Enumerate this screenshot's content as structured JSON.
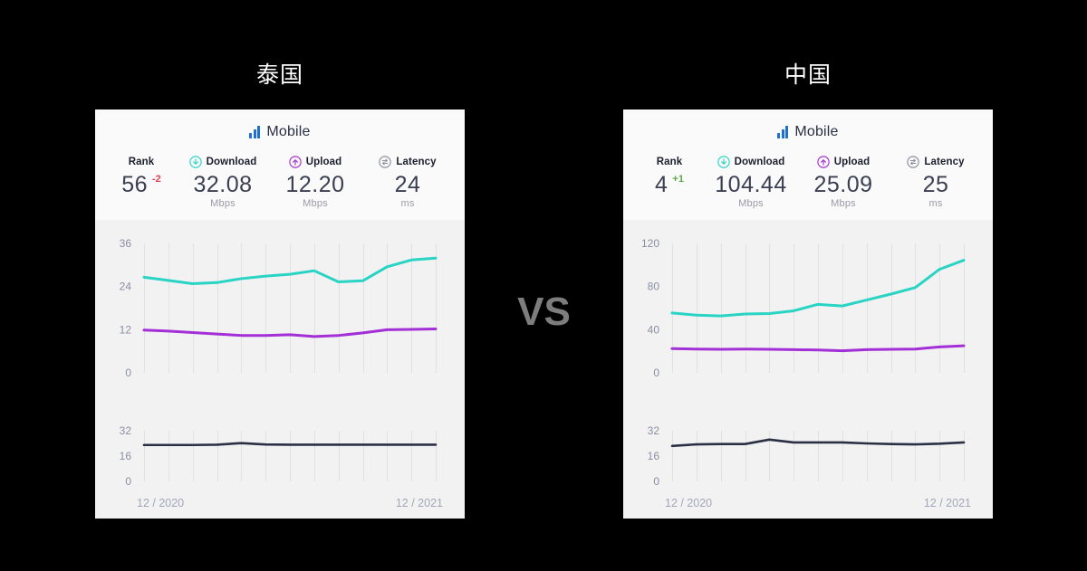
{
  "page": {
    "background": "#000000",
    "vs_label": "VS"
  },
  "colors": {
    "download": "#2ad4c4",
    "upload": "#a32fd6",
    "latency": "#2b2f44",
    "mobile_icon": "#1f6fd0",
    "rank_down": "#e03b4e",
    "rank_up": "#5aa845",
    "card_header_bg": "#fafafa",
    "card_body_bg": "#f2f2f2",
    "axis_text": "#8b8ea3",
    "gridline": "#e2e2e5"
  },
  "cards": [
    {
      "country": "泰国",
      "header": {
        "connection_type": "Mobile",
        "icon": "mobile-signal-bars-icon"
      },
      "metrics": [
        {
          "key": "rank",
          "label": "Rank",
          "icon": null,
          "value": "56",
          "unit": "",
          "delta": "-2",
          "delta_direction": "down"
        },
        {
          "key": "download",
          "label": "Download",
          "icon": "download-arrow-circle-icon",
          "value": "32.08",
          "unit": "Mbps",
          "delta": null,
          "delta_direction": null
        },
        {
          "key": "upload",
          "label": "Upload",
          "icon": "upload-arrow-circle-icon",
          "value": "12.20",
          "unit": "Mbps",
          "delta": null,
          "delta_direction": null
        },
        {
          "key": "latency",
          "label": "Latency",
          "icon": "latency-exchange-circle-icon",
          "value": "24",
          "unit": "ms",
          "delta": null,
          "delta_direction": null
        }
      ],
      "speed_chart": {
        "type": "line",
        "title": "",
        "xlabel": "",
        "ylabel": "",
        "ylim": [
          0,
          36
        ],
        "yticks": [
          0,
          12,
          24,
          36
        ],
        "ytick_labels": [
          "0",
          "12",
          "24",
          "36"
        ],
        "grid": true,
        "x": [
          "12 / 2020",
          "01 / 2021",
          "02 / 2021",
          "03 / 2021",
          "04 / 2021",
          "05 / 2021",
          "06 / 2021",
          "07 / 2021",
          "08 / 2021",
          "09 / 2021",
          "10 / 2021",
          "11 / 2021",
          "12 / 2021"
        ],
        "xtick_labels": [
          "12 / 2020",
          "12 / 2021"
        ],
        "series": [
          {
            "name": "Download",
            "color": "#2ad4c4",
            "values": [
              26.6,
              25.7,
              24.8,
              25.1,
              26.2,
              26.9,
              27.4,
              28.4,
              25.3,
              25.6,
              29.5,
              31.4,
              31.9
            ]
          },
          {
            "name": "Upload",
            "color": "#a32fd6",
            "values": [
              11.9,
              11.6,
              11.2,
              10.8,
              10.4,
              10.4,
              10.6,
              10.1,
              10.4,
              11.1,
              12.0,
              12.1,
              12.2
            ]
          }
        ]
      },
      "latency_chart": {
        "type": "line",
        "ylim": [
          0,
          32
        ],
        "yticks": [
          0,
          16,
          32
        ],
        "ytick_labels": [
          "0",
          "16",
          "32"
        ],
        "grid": true,
        "x": [
          "12 / 2020",
          "01 / 2021",
          "02 / 2021",
          "03 / 2021",
          "04 / 2021",
          "05 / 2021",
          "06 / 2021",
          "07 / 2021",
          "08 / 2021",
          "09 / 2021",
          "10 / 2021",
          "11 / 2021",
          "12 / 2021"
        ],
        "xtick_labels": [
          "12 / 2020",
          "12 / 2021"
        ],
        "series": [
          {
            "name": "Latency",
            "color": "#2b2f44",
            "values": [
              23.0,
              23.0,
              23.0,
              23.2,
              24.2,
              23.3,
              23.2,
              23.2,
              23.2,
              23.2,
              23.2,
              23.2,
              23.2
            ]
          }
        ]
      }
    },
    {
      "country": "中国",
      "header": {
        "connection_type": "Mobile",
        "icon": "mobile-signal-bars-icon"
      },
      "metrics": [
        {
          "key": "rank",
          "label": "Rank",
          "icon": null,
          "value": "4",
          "unit": "",
          "delta": "+1",
          "delta_direction": "up"
        },
        {
          "key": "download",
          "label": "Download",
          "icon": "download-arrow-circle-icon",
          "value": "104.44",
          "unit": "Mbps",
          "delta": null,
          "delta_direction": null
        },
        {
          "key": "upload",
          "label": "Upload",
          "icon": "upload-arrow-circle-icon",
          "value": "25.09",
          "unit": "Mbps",
          "delta": null,
          "delta_direction": null
        },
        {
          "key": "latency",
          "label": "Latency",
          "icon": "latency-exchange-circle-icon",
          "value": "25",
          "unit": "ms",
          "delta": null,
          "delta_direction": null
        }
      ],
      "speed_chart": {
        "type": "line",
        "ylim": [
          0,
          120
        ],
        "yticks": [
          0,
          40,
          80,
          120
        ],
        "ytick_labels": [
          "0",
          "40",
          "80",
          "120"
        ],
        "grid": true,
        "x": [
          "12 / 2020",
          "01 / 2021",
          "02 / 2021",
          "03 / 2021",
          "04 / 2021",
          "05 / 2021",
          "06 / 2021",
          "07 / 2021",
          "08 / 2021",
          "09 / 2021",
          "10 / 2021",
          "11 / 2021",
          "12 / 2021"
        ],
        "xtick_labels": [
          "12 / 2020",
          "12 / 2021"
        ],
        "series": [
          {
            "name": "Download",
            "color": "#2ad4c4",
            "values": [
              55.5,
              53.5,
              52.8,
              54.5,
              55.0,
              57.5,
              63.5,
              62.0,
              67.5,
              73.0,
              79.0,
              96.0,
              104.4
            ]
          },
          {
            "name": "Upload",
            "color": "#a32fd6",
            "values": [
              22.5,
              22.0,
              21.8,
              22.0,
              21.8,
              21.5,
              21.2,
              20.5,
              21.5,
              21.8,
              22.0,
              24.0,
              25.1
            ]
          }
        ]
      },
      "latency_chart": {
        "type": "line",
        "ylim": [
          0,
          32
        ],
        "yticks": [
          0,
          16,
          32
        ],
        "ytick_labels": [
          "0",
          "16",
          "32"
        ],
        "grid": true,
        "x": [
          "12 / 2020",
          "01 / 2021",
          "02 / 2021",
          "03 / 2021",
          "04 / 2021",
          "05 / 2021",
          "06 / 2021",
          "07 / 2021",
          "08 / 2021",
          "09 / 2021",
          "10 / 2021",
          "11 / 2021",
          "12 / 2021"
        ],
        "xtick_labels": [
          "12 / 2020",
          "12 / 2021"
        ],
        "series": [
          {
            "name": "Latency",
            "color": "#2b2f44",
            "values": [
              22.4,
              23.4,
              23.6,
              23.6,
              26.4,
              24.6,
              24.6,
              24.6,
              24.0,
              23.6,
              23.4,
              23.8,
              24.6
            ]
          }
        ]
      }
    }
  ]
}
